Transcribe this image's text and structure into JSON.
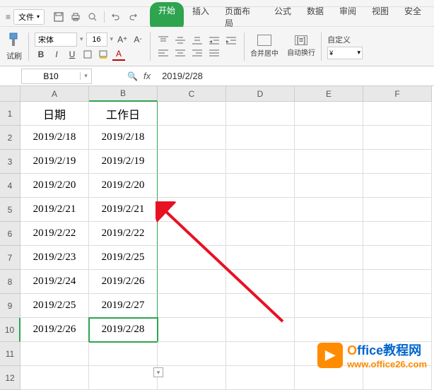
{
  "menubar": {
    "file_label": "文件",
    "tabs": [
      "开始",
      "插入",
      "页面布局",
      "公式",
      "数据",
      "审阅",
      "视图",
      "安全"
    ],
    "active_tab": 0
  },
  "ribbon": {
    "brush_label": "试刷",
    "font_name": "宋体",
    "font_size": "16",
    "merge_label": "合并居中",
    "wrap_label": "自动换行",
    "custom_label": "自定义",
    "currency_symbol": "¥"
  },
  "formula_bar": {
    "name_box": "B10",
    "fx": "fx",
    "value": "2019/2/28"
  },
  "columns": [
    "A",
    "B",
    "C",
    "D",
    "E",
    "F"
  ],
  "rows": [
    1,
    2,
    3,
    4,
    5,
    6,
    7,
    8,
    9,
    10,
    11,
    12
  ],
  "data": {
    "A1": "日期",
    "B1": "工作日",
    "A2": "2019/2/18",
    "B2": "2019/2/18",
    "A3": "2019/2/19",
    "B3": "2019/2/19",
    "A4": "2019/2/20",
    "B4": "2019/2/20",
    "A5": "2019/2/21",
    "B5": "2019/2/21",
    "A6": "2019/2/22",
    "B6": "2019/2/22",
    "A7": "2019/2/23",
    "B7": "2019/2/25",
    "A8": "2019/2/24",
    "B8": "2019/2/26",
    "A9": "2019/2/25",
    "B9": "2019/2/27",
    "A10": "2019/2/26",
    "B10": "2019/2/28"
  },
  "selected_cell": "B10",
  "watermark": {
    "title_orange": "O",
    "title_blue": "ffice教程网",
    "url": "www.office26.com"
  }
}
